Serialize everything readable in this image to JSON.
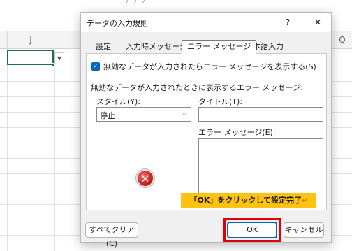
{
  "sheet": {
    "top_glimpse": "ナ     ナ   ナ",
    "col_headers": [
      "J",
      "Q"
    ]
  },
  "dialog": {
    "title": "データの入力規則",
    "help": "?",
    "close": "✕",
    "tabs": [
      {
        "label": "設定",
        "active": false
      },
      {
        "label": "入力時メッセージ",
        "active": false
      },
      {
        "label": "エラー メッセージ",
        "active": true
      },
      {
        "label": "日本語入力",
        "active": false
      }
    ],
    "show_error_checkbox": {
      "checked": true,
      "label": "無効なデータが入力されたらエラー メッセージを表示する(S)"
    },
    "section_label": "無効なデータが入力されたときに表示するエラー メッセージ:",
    "style": {
      "label": "スタイル(Y):",
      "value": "停止"
    },
    "title_field": {
      "label": "タイトル(T):",
      "value": ""
    },
    "message_field": {
      "label": "エラー メッセージ(E):",
      "value": ""
    },
    "icon": "error-icon",
    "clear_all": "すべてクリア(C)",
    "ok": "OK",
    "cancel": "キャンセル"
  },
  "annotation": {
    "text": "「OK」をクリックして設定完了",
    "mark": "↵",
    "color": "#ffc20e",
    "highlight_color": "#e00000"
  }
}
